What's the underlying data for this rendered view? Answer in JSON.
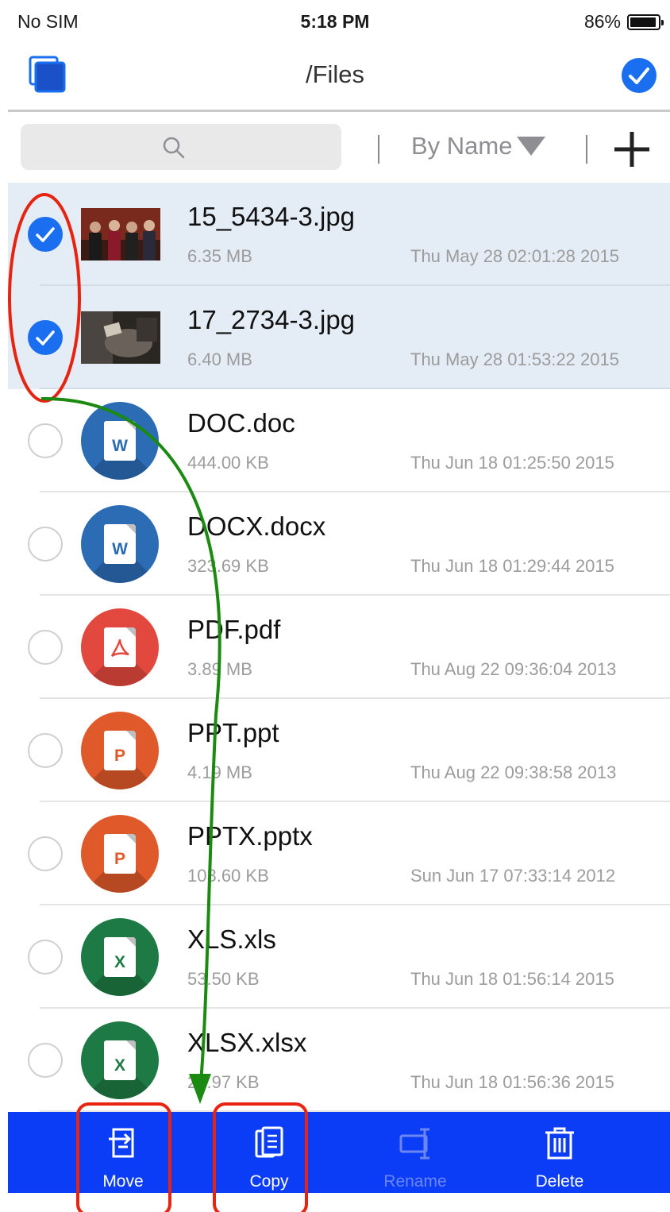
{
  "status_bar": {
    "carrier": "No SIM",
    "time": "5:18 PM",
    "battery": "86%"
  },
  "nav": {
    "title": "/Files",
    "left_icon": "copies-icon",
    "right_icon": "checkmark-circle-icon"
  },
  "search": {
    "placeholder": "",
    "icon": "search-icon"
  },
  "sort": {
    "label": "By Name",
    "icon": "triangle-down-icon"
  },
  "add": {
    "icon": "plus-icon"
  },
  "files": [
    {
      "name": "15_5434-3.jpg",
      "size": "6.35 MB",
      "date": "Thu May 28 02:01:28 2015",
      "kind": "image",
      "selected": true
    },
    {
      "name": "17_2734-3.jpg",
      "size": "6.40 MB",
      "date": "Thu May 28 01:53:22 2015",
      "kind": "image",
      "selected": true
    },
    {
      "name": "DOC.doc",
      "size": "444.00 KB",
      "date": "Thu Jun 18 01:25:50 2015",
      "kind": "word",
      "letter": "W",
      "selected": false
    },
    {
      "name": "DOCX.docx",
      "size": "323.69 KB",
      "date": "Thu Jun 18 01:29:44 2015",
      "kind": "word",
      "letter": "W",
      "selected": false
    },
    {
      "name": "PDF.pdf",
      "size": "3.89 MB",
      "date": "Thu Aug 22 09:36:04 2013",
      "kind": "pdf",
      "letter": "",
      "selected": false
    },
    {
      "name": "PPT.ppt",
      "size": "4.19 MB",
      "date": "Thu Aug 22 09:38:58 2013",
      "kind": "powerpoint",
      "letter": "P",
      "selected": false
    },
    {
      "name": "PPTX.pptx",
      "size": "103.60 KB",
      "date": "Sun Jun 17 07:33:14 2012",
      "kind": "powerpoint",
      "letter": "P",
      "selected": false
    },
    {
      "name": "XLS.xls",
      "size": "53.50 KB",
      "date": "Thu Jun 18 01:56:14 2015",
      "kind": "excel",
      "letter": "X",
      "selected": false
    },
    {
      "name": "XLSX.xlsx",
      "size": "20.97 KB",
      "date": "Thu Jun 18 01:56:36 2015",
      "kind": "excel",
      "letter": "X",
      "selected": false
    }
  ],
  "actions": [
    {
      "label": "Move",
      "icon": "move-icon",
      "enabled": true
    },
    {
      "label": "Copy",
      "icon": "copy-icon",
      "enabled": true
    },
    {
      "label": "Rename",
      "icon": "rename-icon",
      "enabled": false
    },
    {
      "label": "Delete",
      "icon": "trash-icon",
      "enabled": true
    }
  ],
  "colors": {
    "accent": "#1a6ff0",
    "action_bar": "#0c3df6",
    "selected_row": "#e4ecf6",
    "word": "#2b6cb5",
    "pdf": "#e2483d",
    "powerpoint": "#e0592a",
    "excel": "#1e7a44",
    "annotation_red": "#e8230f",
    "annotation_green": "#1a8a10"
  }
}
